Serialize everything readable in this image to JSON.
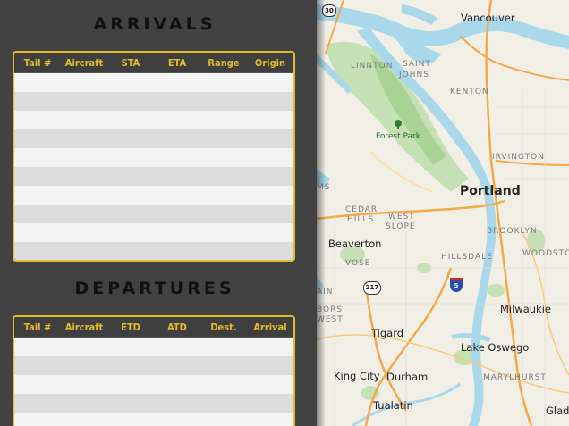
{
  "arrivals": {
    "title": "ARRIVALS",
    "columns": [
      "Tail #",
      "Aircraft",
      "STA",
      "ETA",
      "Range",
      "Origin"
    ],
    "row_count": 10
  },
  "departures": {
    "title": "DEPARTURES",
    "columns": [
      "Tail #",
      "Aircraft",
      "ETD",
      "ATD",
      "Dest.",
      "Arrival"
    ],
    "row_count": 5
  },
  "map": {
    "labels": {
      "vancouver": "Vancouver",
      "linnton": "LINNTON",
      "saint_johns_1": "SAINT",
      "saint_johns_2": "JOHNS",
      "kenton": "KENTON",
      "forest_park": "Forest Park",
      "irvington": "IRVINGTON",
      "portland": "Portland",
      "cedar_hills_1": "CEDAR",
      "cedar_hills_2": "HILLS",
      "west_slope_1": "WEST",
      "west_slope_2": "SLOPE",
      "brooklyn": "BROOKLYN",
      "beaverton": "Beaverton",
      "woodstock": "WOODSTOC",
      "hillsdale": "HILLSDALE",
      "vose": "VOSE",
      "ms": "MS",
      "ain": "AIN",
      "milwaukie": "Milwaukie",
      "bors_1": "BORS",
      "bors_2": "WEST",
      "tigard": "Tigard",
      "lake_oswego": "Lake Oswego",
      "king_city": "King City",
      "durham": "Durham",
      "marylhurst": "MARYLHURST",
      "tualatin": "Tualatin",
      "glads": "Glads"
    },
    "shields": {
      "r30": "30",
      "r217": "217",
      "r5": "5"
    }
  }
}
